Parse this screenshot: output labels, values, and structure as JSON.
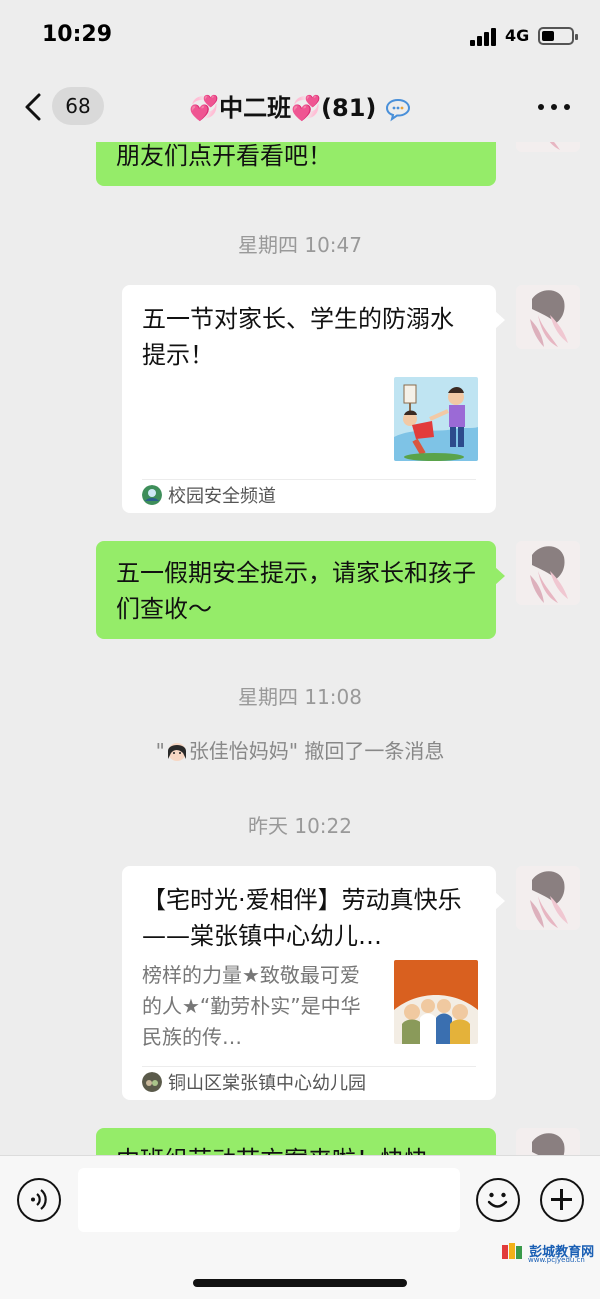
{
  "status_bar": {
    "time": "10:29",
    "network": "4G"
  },
  "nav": {
    "unread_count": "68",
    "title": "中二班",
    "member_count": "(81)"
  },
  "messages": [
    {
      "kind": "text",
      "text": "朋友们点开看看吧！"
    },
    {
      "kind": "timestamp",
      "text": "星期四 10:47"
    },
    {
      "kind": "card",
      "title": "五一节对家长、学生的防溺水提示！",
      "source": "校园安全频道"
    },
    {
      "kind": "text",
      "text": "五一假期安全提示，请家长和孩子们查收～"
    },
    {
      "kind": "timestamp",
      "text": "星期四 11:08"
    },
    {
      "kind": "system",
      "quote_open": "\"",
      "name": "张佳怡妈妈",
      "quote_close": "\"",
      "action": " 撤回了一条消息"
    },
    {
      "kind": "timestamp",
      "text": "昨天 10:22"
    },
    {
      "kind": "card",
      "title": "【宅时光·爱相伴】劳动真快乐——棠张镇中心幼儿…",
      "description": "榜样的力量★致敬最可爱的人★“勤劳朴实”是中华民族的传…",
      "source": "铜山区棠张镇中心幼儿园"
    },
    {
      "kind": "text",
      "text": "中班组劳动节方案来啦！快快"
    }
  ],
  "input": {
    "placeholder": ""
  },
  "watermark": {
    "text": "彭城教育网",
    "url": "www.pcjyedu.cn"
  },
  "colors": {
    "bubble_green": "#95ec69",
    "background": "#ededed",
    "heart": "#e8479a"
  }
}
